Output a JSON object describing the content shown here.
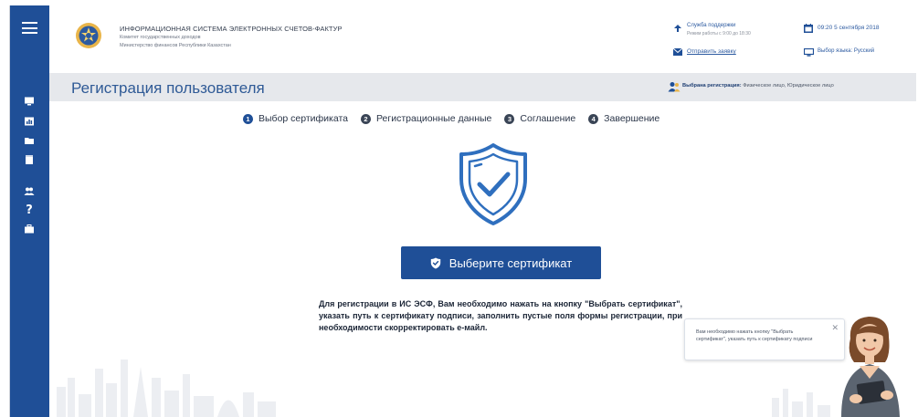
{
  "header": {
    "system_title": "ИНФОРМАЦИОННАЯ СИСТЕМА ЭЛЕКТРОННЫХ СЧЕТОВ-ФАКТУР",
    "committee": "Комитет государственных доходов",
    "ministry": "Министерство финансов Республики Казахстан",
    "support_title": "Служба поддержки",
    "support_hours": "Режим работы с 9:00 до 18:30",
    "send_request": "Отправить заявку",
    "datetime": "09:20 5 сентября 2018",
    "language": "Выбор языка: Русский"
  },
  "titlebar": {
    "page_title": "Регистрация пользователя",
    "reg_choice_label": "Выбрана регистрация:",
    "reg_choice_value": "Физическое лицо, Юридическое лицо"
  },
  "steps": [
    {
      "num": "1",
      "label": "Выбор сертификата"
    },
    {
      "num": "2",
      "label": "Регистрационные данные"
    },
    {
      "num": "3",
      "label": "Соглашение"
    },
    {
      "num": "4",
      "label": "Завершение"
    }
  ],
  "main": {
    "cert_button": "Выберите сертификат",
    "instructions": "Для регистрации в ИС ЭСФ, Вам необходимо нажать на кнопку \"Выбрать сертификат\", указать путь к сертификату подписи, заполнить пустые поля формы регистрации, при необходимости скорректировать е-майл."
  },
  "assistant": {
    "tooltip": "Вам необходимо нажать кнопку \"Выбрать сертификат\", указать путь к сертификату подписи",
    "close": "✕"
  },
  "icons": [
    "menu-icon",
    "monitor-icon",
    "chart-icon",
    "folder-icon",
    "document-icon",
    "group-icon",
    "help-icon",
    "briefcase-icon",
    "emblem-icon",
    "support-icon",
    "mail-icon",
    "calendar-icon",
    "language-monitor-icon",
    "users-icon",
    "shield-check-icon",
    "close-icon"
  ],
  "colors": {
    "primary": "#1f4f97",
    "titlebar_bg": "#e6e8ec",
    "title_text": "#2f5a96",
    "text_dark": "#1b2536",
    "shield_stroke": "#2f6fbe"
  }
}
